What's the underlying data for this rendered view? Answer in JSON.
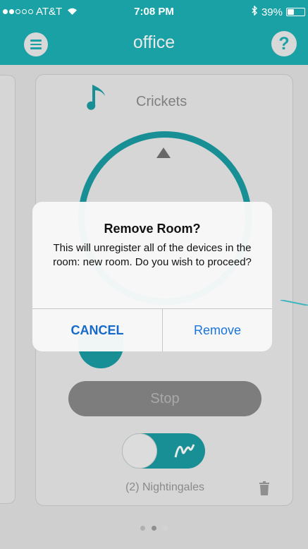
{
  "status_bar": {
    "carrier": "AT&T",
    "time": "7:08 PM",
    "battery": "39%",
    "battery_level": 0.39
  },
  "nav": {
    "title": "office",
    "help": "?"
  },
  "card": {
    "sound_name": "Crickets",
    "stop_label": "Stop",
    "device_name": "(2) Nightingales"
  },
  "alert": {
    "title": "Remove Room?",
    "message": "This will unregister all of the devices in the room: new room. Do you wish to proceed?",
    "cancel_label": "CANCEL",
    "remove_label": "Remove"
  },
  "pagination": {
    "count": 3,
    "active": 2
  },
  "colors": {
    "accent": "#1aa1a6",
    "alert_button": "#1a74db"
  }
}
